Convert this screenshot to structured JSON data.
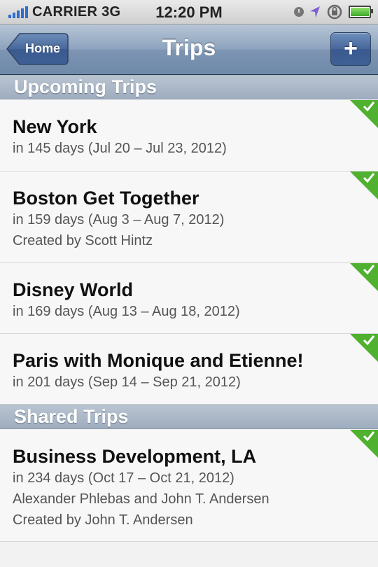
{
  "status_bar": {
    "carrier": "CARRIER",
    "network": "3G",
    "time": "12:20 PM",
    "icons": [
      "signal-icon",
      "clock-icon",
      "location-icon",
      "rotation-lock-icon",
      "battery-icon"
    ]
  },
  "nav": {
    "back_label": "Home",
    "title": "Trips",
    "add_label": "+"
  },
  "colors": {
    "check_green": "#4fb12f",
    "nav_blue": "#7d95b3"
  },
  "sections": {
    "upcoming": {
      "title": "Upcoming Trips",
      "trips": [
        {
          "name": "New York",
          "when": "in 145 days (Jul 20 – Jul 23, 2012)"
        },
        {
          "name": "Boston Get Together",
          "when": "in 159 days (Aug 3 – Aug 7, 2012)",
          "created_by": "Created by Scott Hintz"
        },
        {
          "name": "Disney World",
          "when": "in 169 days (Aug 13 – Aug 18, 2012)"
        },
        {
          "name": "Paris with Monique and Etienne!",
          "when": "in 201 days (Sep 14 – Sep 21, 2012)"
        }
      ]
    },
    "shared": {
      "title": "Shared Trips",
      "trips": [
        {
          "name": "Business Development, LA",
          "when": "in 234 days (Oct 17 – Oct 21, 2012)",
          "members": "Alexander Phlebas and John T. Andersen",
          "created_by": "Created by John T. Andersen"
        }
      ]
    }
  }
}
